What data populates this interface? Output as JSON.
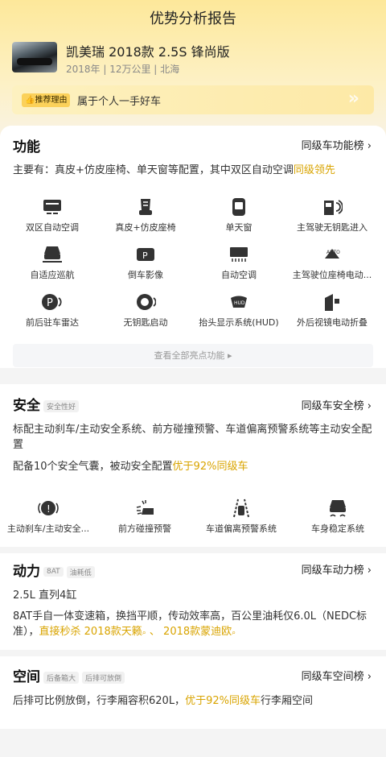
{
  "page_title": "优势分析报告",
  "car": {
    "name": "凯美瑞 2018款 2.5S 锋尚版",
    "meta": "2018年 | 12万公里 | 北海"
  },
  "reason": {
    "tag": "推荐理由",
    "text": "属于个人一手好车"
  },
  "function": {
    "title": "功能",
    "rank_label": "同级车功能榜 ›",
    "summary_prefix": "主要有：真皮+仿皮座椅、单天窗等配置，其中双区自动空调",
    "summary_highlight": "同级领先",
    "items": [
      {
        "label": "双区自动空调",
        "icon": "dual-zone-ac-icon"
      },
      {
        "label": "真皮+仿皮座椅",
        "icon": "leather-seat-icon"
      },
      {
        "label": "单天窗",
        "icon": "sunroof-icon"
      },
      {
        "label": "主驾驶无钥匙进入",
        "icon": "keyless-entry-icon"
      },
      {
        "label": "自适应巡航",
        "icon": "adaptive-cruise-icon"
      },
      {
        "label": "倒车影像",
        "icon": "reverse-camera-icon"
      },
      {
        "label": "自动空调",
        "icon": "auto-ac-icon"
      },
      {
        "label": "主驾驶位座椅电动...",
        "icon": "power-seat-icon"
      },
      {
        "label": "前后驻车雷达",
        "icon": "parking-radar-icon"
      },
      {
        "label": "无钥匙启动",
        "icon": "keyless-start-icon"
      },
      {
        "label": "抬头显示系统(HUD)",
        "icon": "hud-icon"
      },
      {
        "label": "外后视镜电动折叠",
        "icon": "mirror-fold-icon"
      }
    ],
    "more_label": "查看全部亮点功能 ▸"
  },
  "safety": {
    "title": "安全",
    "tag": "安全性好",
    "rank_label": "同级车安全榜 ›",
    "para1": "标配主动刹车/主动安全系统、前方碰撞预警、车道偏离预警系统等主动安全配置",
    "para2_prefix": "配备10个安全气囊，被动安全配置",
    "para2_highlight": "优于92%同级车",
    "items": [
      {
        "label": "主动刹车/主动安全...",
        "icon": "active-brake-icon"
      },
      {
        "label": "前方碰撞预警",
        "icon": "collision-warning-icon"
      },
      {
        "label": "车道偏离预警系统",
        "icon": "lane-departure-icon"
      },
      {
        "label": "车身稳定系统",
        "icon": "stability-control-icon"
      }
    ]
  },
  "power": {
    "title": "动力",
    "tags": [
      "8AT",
      "油耗低"
    ],
    "rank_label": "同级车动力榜 ›",
    "engine": "2.5L 直列4缸",
    "para_prefix": "8AT手自一体变速箱，换挡平顺，传动效率高，百公里油耗仅6.0L（NEDC标准），",
    "para_highlight": "直接秒杀 2018款天籁",
    "sep": " 、 ",
    "para_highlight2": "2018款蒙迪欧"
  },
  "space": {
    "title": "空间",
    "tags": [
      "后备箱大",
      "后排可放倒"
    ],
    "rank_label": "同级车空间榜 ›",
    "para_prefix": "后排可比例放倒，行李厢容积620L，",
    "para_highlight": "优于92%同级车",
    "para_suffix": "行李厢空间"
  }
}
